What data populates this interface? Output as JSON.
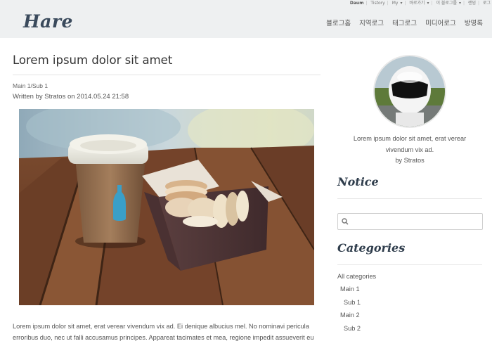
{
  "topbar": {
    "links": [
      "Daum",
      "Tistory",
      "My",
      "바로가기",
      "이 블로그를",
      "랜덤",
      "로그"
    ]
  },
  "header": {
    "logo": "Hare",
    "nav": [
      "블로그홈",
      "지역로그",
      "태그로그",
      "미디어로그",
      "방명록"
    ]
  },
  "post": {
    "title": "Lorem ipsum dolor sit amet",
    "category": "Main 1/Sub 1",
    "meta": "Written by Stratos on 2014.05.24 21:58",
    "body": "Lorem ipsum dolor sit amet, erat verear vivendum vix ad. Ei denique albucius mel. No nominavi pericula erroribus duo, nec ut falli accusamus principes. Appareat tacimates et mea, regione impedit assueverit eu cum. Cu mei facer habemus consetetur tacimates mnesarchum ea vix id. Per eu lobortis iudicabit"
  },
  "sidebar": {
    "profile_desc_line1": "Lorem ipsum dolor sit amet, erat verear",
    "profile_desc_line2": "vivendum vix ad.",
    "profile_by": "by Stratos",
    "notice_title": "Notice",
    "search_placeholder": "",
    "categories_title": "Categories",
    "categories": [
      {
        "label": "All categories"
      },
      {
        "label": "Main 1"
      },
      {
        "label": "Sub 1"
      },
      {
        "label": "Main 2"
      },
      {
        "label": "Sub 2"
      }
    ]
  },
  "colors": {
    "header_bg": "#eef0f1",
    "heading": "#2f3d4c",
    "text": "#555555"
  }
}
